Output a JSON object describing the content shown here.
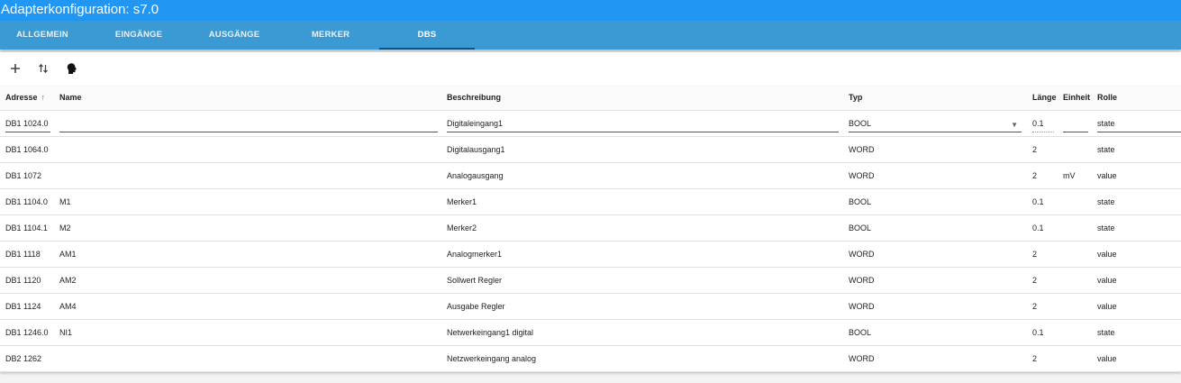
{
  "window": {
    "title": "Adapterkonfiguration: s7.0"
  },
  "tabs": [
    {
      "label": "ALLGEMEIN"
    },
    {
      "label": "EINGÄNGE"
    },
    {
      "label": "AUSGÄNGE"
    },
    {
      "label": "MERKER"
    },
    {
      "label": "DBS",
      "active": true
    }
  ],
  "toolbar": {
    "icons": [
      "plus-icon",
      "sort-swap-icon",
      "head-icon"
    ]
  },
  "table": {
    "columns": {
      "adresse": "Adresse",
      "name": "Name",
      "beschreibung": "Beschreibung",
      "typ": "Typ",
      "laenge": "Länge",
      "einheit": "Einheit",
      "rolle": "Rolle"
    },
    "sort_indicator": "↑",
    "edit_row": {
      "adresse": "DB1 1024.0",
      "name": "",
      "beschreibung": "Digitaleingang1",
      "typ": "BOOL",
      "laenge": "0.1",
      "einheit": "",
      "rolle": "state",
      "dropdown_arrow": "▼"
    },
    "rows": [
      {
        "adresse": "DB1 1064.0",
        "name": "",
        "beschreibung": "Digitalausgang1",
        "typ": "WORD",
        "laenge": "2",
        "einheit": "",
        "rolle": "state"
      },
      {
        "adresse": "DB1 1072",
        "name": "",
        "beschreibung": "Analogausgang",
        "typ": "WORD",
        "laenge": "2",
        "einheit": "mV",
        "rolle": "value"
      },
      {
        "adresse": "DB1 1104.0",
        "name": "M1",
        "beschreibung": "Merker1",
        "typ": "BOOL",
        "laenge": "0.1",
        "einheit": "",
        "rolle": "state"
      },
      {
        "adresse": "DB1 1104.1",
        "name": "M2",
        "beschreibung": "Merker2",
        "typ": "BOOL",
        "laenge": "0.1",
        "einheit": "",
        "rolle": "state"
      },
      {
        "adresse": "DB1 1118",
        "name": "AM1",
        "beschreibung": "Analogmerker1",
        "typ": "WORD",
        "laenge": "2",
        "einheit": "",
        "rolle": "value"
      },
      {
        "adresse": "DB1 1120",
        "name": "AM2",
        "beschreibung": "Sollwert Regler",
        "typ": "WORD",
        "laenge": "2",
        "einheit": "",
        "rolle": "value"
      },
      {
        "adresse": "DB1 1124",
        "name": "AM4",
        "beschreibung": "Ausgabe Regler",
        "typ": "WORD",
        "laenge": "2",
        "einheit": "",
        "rolle": "value"
      },
      {
        "adresse": "DB1 1246.0",
        "name": "NI1",
        "beschreibung": "Netwerkeingang1 digital",
        "typ": "BOOL",
        "laenge": "0.1",
        "einheit": "",
        "rolle": "state"
      },
      {
        "adresse": "DB2 1262",
        "name": "",
        "beschreibung": "Netzwerkeingang analog",
        "typ": "WORD",
        "laenge": "2",
        "einheit": "",
        "rolle": "value"
      }
    ]
  },
  "colors": {
    "titlebar": "#2196f3",
    "tabbar": "#3b9ad3",
    "active_tab_indicator": "#1b4f7a"
  }
}
